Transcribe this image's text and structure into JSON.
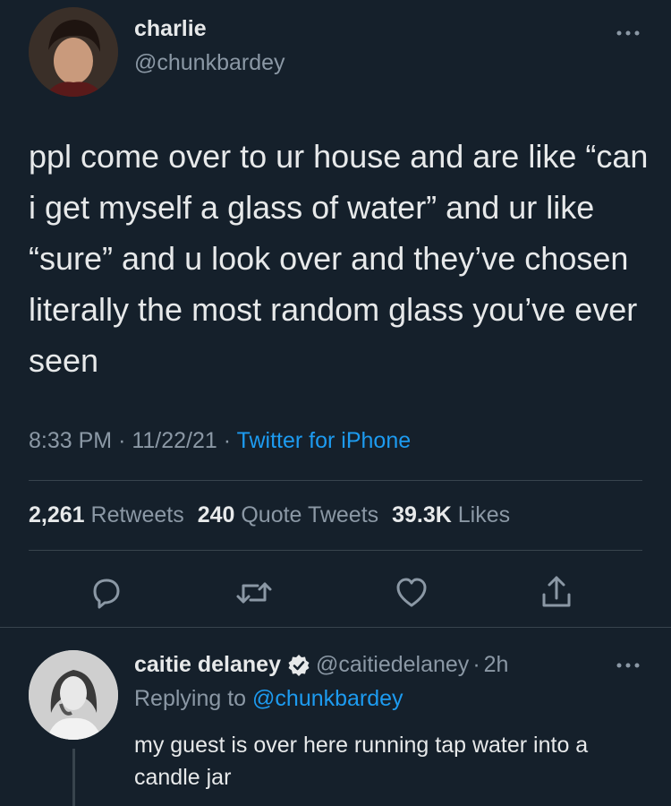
{
  "tweet": {
    "author_name": "charlie",
    "author_handle": "@chunkbardey",
    "more_icon": "more-horizontal-icon",
    "text": "ppl come over to ur house and are like “can i get myself a glass of water” and ur like “sure” and u look over and they’ve chosen literally the most random glass you’ve ever seen",
    "time": "8:33 PM",
    "date": "11/22/21",
    "dot": "·",
    "source": "Twitter for iPhone",
    "stats": {
      "retweets_count": "2,261",
      "retweets_label": "Retweets",
      "quotes_count": "240",
      "quotes_label": "Quote Tweets",
      "likes_count": "39.3K",
      "likes_label": "Likes"
    },
    "actions": [
      "reply-icon",
      "retweet-icon",
      "like-icon",
      "share-icon"
    ]
  },
  "reply": {
    "author_name": "caitie delaney",
    "verified_icon": "verified-badge-icon",
    "author_handle": "@caitiedelaney",
    "dot": "·",
    "time": "2h",
    "replying_prefix": "Replying to",
    "replying_handle": "@chunkbardey",
    "text": "my guest is over here running tap water into a candle jar"
  },
  "colors": {
    "background": "#15202b",
    "text": "#e7e9ea",
    "muted": "#8b98a5",
    "accent": "#1d9bf0"
  }
}
